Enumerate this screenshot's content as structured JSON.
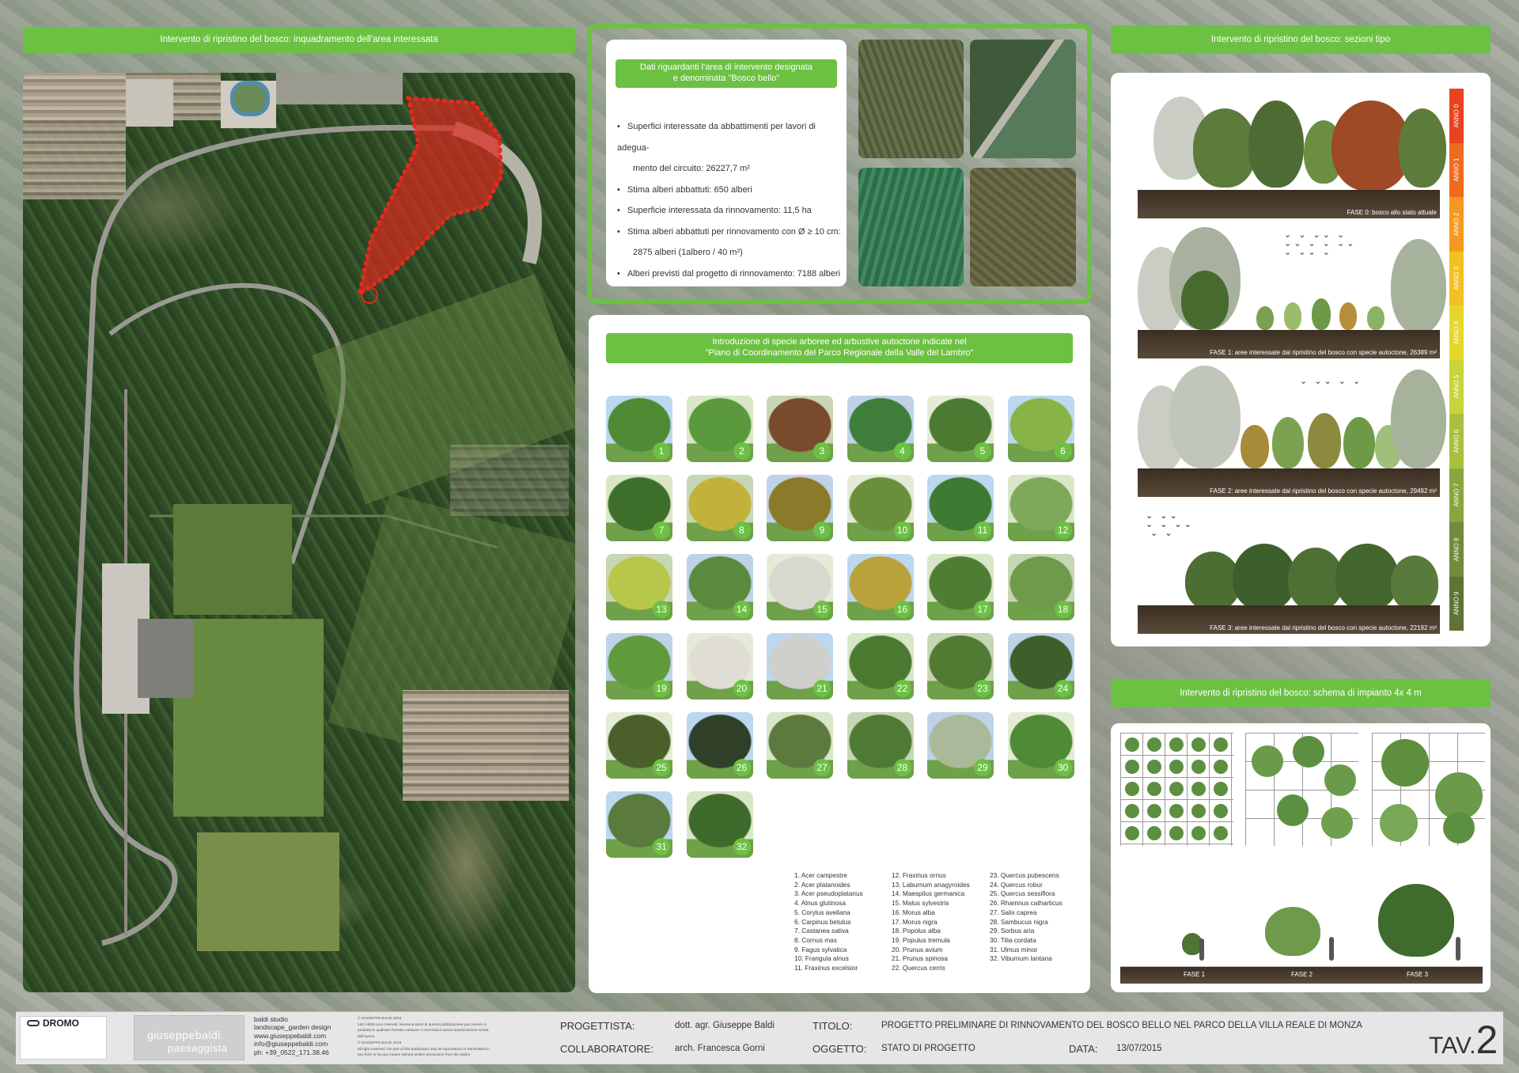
{
  "left": {
    "title": "Intervento di ripristino del bosco: inquadramento dell'area interessata"
  },
  "data_panel": {
    "title_line1": "Dati riguardanti l'area di intervento designata",
    "title_line2": "e denominata \"Bosco bello\"",
    "bullets": [
      "Superfici interessate da abbattimenti per lavori di adegua-",
      "mento del circuito: 26227,7 m²",
      "Stima alberi abbattuti: 650 alberi",
      "Superficie interessata da rinnovamento: 11,5 ha",
      "Stima alberi abbattuti per rinnovamento con Ø ≥ 10 cm:",
      "2875 alberi (1albero / 40 m²)",
      "Alberi previsti dal progetto di rinnovamento: 7188 alberi"
    ]
  },
  "species": {
    "title_line1": "Introduzione di specie arboree ed arbustive autoctone indicate nel",
    "title_line2": "\"Piano di Coordinamento del Parco Regionale della Valle del Lambro\"",
    "numbers": [
      "1",
      "2",
      "3",
      "4",
      "5",
      "6",
      "7",
      "8",
      "9",
      "10",
      "11",
      "12",
      "13",
      "14",
      "15",
      "16",
      "17",
      "18",
      "19",
      "20",
      "21",
      "22",
      "23",
      "24",
      "25",
      "26",
      "27",
      "28",
      "29",
      "30",
      "31",
      "32"
    ],
    "list_col1": [
      "1.    Acer campestre",
      "2.    Acer platanoides",
      "3.    Acer pseudoplatanus",
      "4.    Alnus glutinosa",
      "5.    Corylus avellana",
      "6.    Carpinus betulus",
      "7.    Castanea sativa",
      "8.    Cornus mas",
      "9.    Fagus sylvatica",
      "10.  Frangula alnus",
      "11.  Fraxinus excelsior"
    ],
    "list_col2": [
      "12. Fraxinus ornus",
      "13. Laburnum anagyroides",
      "14. Maespilus germanica",
      "15. Malus sylvestris",
      "16. Morus alba",
      "17. Morus nigra",
      "18. Popolus alba",
      "19. Populus tremula",
      "20. Prunus avium",
      "21. Prunus spinosa",
      "22. Quercus cerris"
    ],
    "list_col3": [
      "23. Quercus pubescens",
      "24. Quercus robur",
      "25. Quercus sessiflora",
      "26. Rhamnus catharticus",
      "27. Salix caprea",
      "28. Sambucus nigra",
      "29. Sorbus aria",
      "30. Tilia cordata",
      "31. Ulmus minor",
      "32. Viburnum lantana"
    ]
  },
  "sections": {
    "title": "Intervento di ripristino del bosco: sezioni tipo",
    "fase0": "FASE 0: bosco allo stato attuale",
    "fase1": "FASE 1: aree interessate dal ripristino del bosco con specie autoctone, 26389 m²",
    "fase2": "FASE 2: aree interessate dal ripristino del bosco con specie autoctone, 29492 m²",
    "fase3": "FASE 3: aree interessate dal ripristino del bosco con specie autoctone, 22192 m²",
    "anni": [
      "ANNO 0",
      "ANNO 1",
      "ANNO 2",
      "ANNO 3",
      "ANNO 4",
      "ANNO 5",
      "ANNO 6",
      "ANNO 7",
      "ANNO 8",
      "ANNO 9"
    ],
    "anni_colors": [
      "#e8421f",
      "#ef6b1e",
      "#f4981f",
      "#f3c021",
      "#e7d72a",
      "#c9d33a",
      "#a9bf3e",
      "#8aa43f",
      "#718a3c",
      "#5e7335"
    ]
  },
  "schema": {
    "title": "Intervento di ripristino del bosco: schema di impianto 4x 4 m",
    "fase_labels": [
      "FASE 1",
      "FASE 2",
      "FASE 3"
    ]
  },
  "footer": {
    "logo_text": "DROMO",
    "studio_lines": [
      "baldi studio",
      "landscape_garden design",
      "www.giuseppebaldi.com",
      "info@giuseppebaldi.com",
      "ph: +39_0522_171.38.46"
    ],
    "brand_line1": "giuseppebaldi",
    "brand_line2": "paesaggista",
    "copyright_lines": [
      "© GIUSEPPE BALDI 2015",
      "tutti i diritti sono riservati. Nessuna parte di questa pubblicazione può essere ri-",
      "prodotta in qualsiasi formato cartaceo o informatico senza autorizzazione scritta",
      "dell'autore",
      "© GIUSEPPE BALDI 2015",
      "all right reserved. No part of this publication may be reproduced or transmitted in",
      "any form or by any means without written permission from the author"
    ],
    "progettista_label": "PROGETTISTA:",
    "progettista_value": "dott. agr. Giuseppe Baldi",
    "collaboratore_label": "COLLABORATORE:",
    "collaboratore_value": "arch.  Francesca Gorni",
    "titolo_label": "TITOLO:",
    "titolo_value": "PROGETTO PRELIMINARE DI RINNOVAMENTO DEL BOSCO BELLO NEL PARCO DELLA VILLA REALE DI MONZA",
    "oggetto_label": "OGGETTO:",
    "oggetto_value": "STATO DI PROGETTO",
    "data_label": "DATA:",
    "data_value": "13/07/2015",
    "tav_prefix": "TAV.",
    "tav_number": "2"
  }
}
